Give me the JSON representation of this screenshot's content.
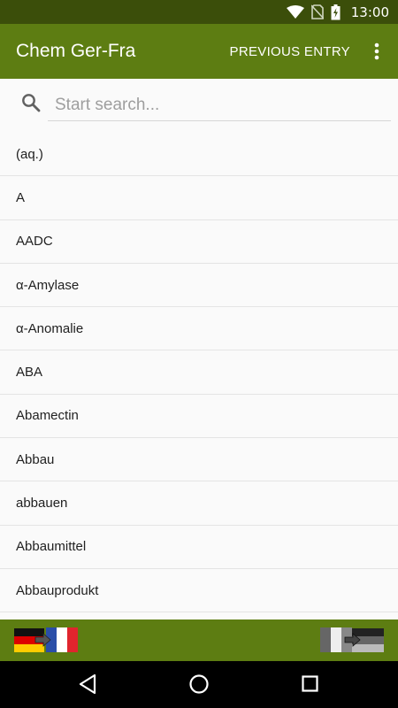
{
  "status_bar": {
    "time": "13:00",
    "icons": [
      "wifi-icon",
      "no-sim-icon",
      "battery-charging-icon"
    ]
  },
  "app_bar": {
    "title": "Chem Ger-Fra",
    "previous_entry_label": "PREVIOUS ENTRY",
    "overflow_icon": "more-vert-icon"
  },
  "search": {
    "placeholder": "Start search...",
    "value": "",
    "icon": "search-icon"
  },
  "list": {
    "items": [
      "(aq.)",
      "A",
      "AADC",
      "α-Amylase",
      "α-Anomalie",
      "ABA",
      "Abamectin",
      "Abbau",
      "abbauen",
      "Abbaumittel",
      "Abbauprodukt"
    ]
  },
  "bottom_bar": {
    "left_button": "german-to-french-flag-icon",
    "right_button": "switch-direction-icon"
  },
  "nav_bar": {
    "buttons": [
      "back-icon",
      "home-icon",
      "recents-icon"
    ]
  },
  "colors": {
    "status_bar": "#3b4e0a",
    "app_bar": "#5d7d12",
    "background": "#fafafa",
    "divider": "#e4e4e4"
  }
}
